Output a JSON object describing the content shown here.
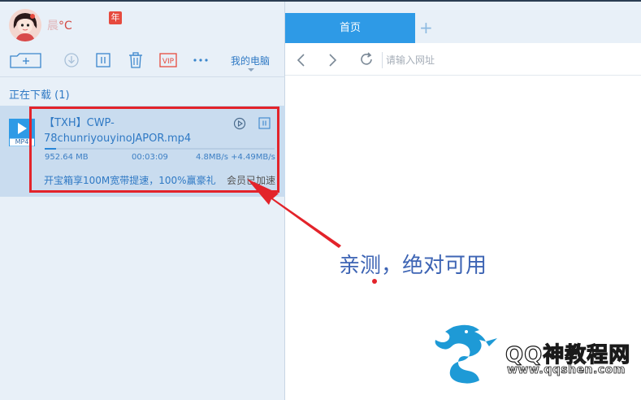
{
  "user": {
    "name": "晨",
    "weather": "°C",
    "year_badge": "年"
  },
  "toolbar": {
    "location_label": "我的电脑"
  },
  "downloads": {
    "section_title": "正在下载 (1)",
    "item": {
      "file_name": "【TXH】CWP-78chunriyouyinoJAPOR.mp4",
      "type_badge": "MP4",
      "size": "952.64 MB",
      "elapsed": "00:03:09",
      "speed": "4.8MB/s +4.49MB/s",
      "progress_fraction": 0.05,
      "promo": "开宝箱享100M宽带提速，100%赢豪礼",
      "member_speedup": "会员已加速"
    }
  },
  "browser": {
    "tab_label": "首页",
    "new_tab_symbol": "+",
    "url_placeholder": "请输入网址"
  },
  "annotation": {
    "text": "亲测，绝对可用"
  },
  "watermark": {
    "title": "QQ神教程网",
    "url": "www.qqshen.com"
  },
  "colors": {
    "accent": "#2e9ae6",
    "highlight": "#e3232a",
    "link": "#2f79c4"
  }
}
